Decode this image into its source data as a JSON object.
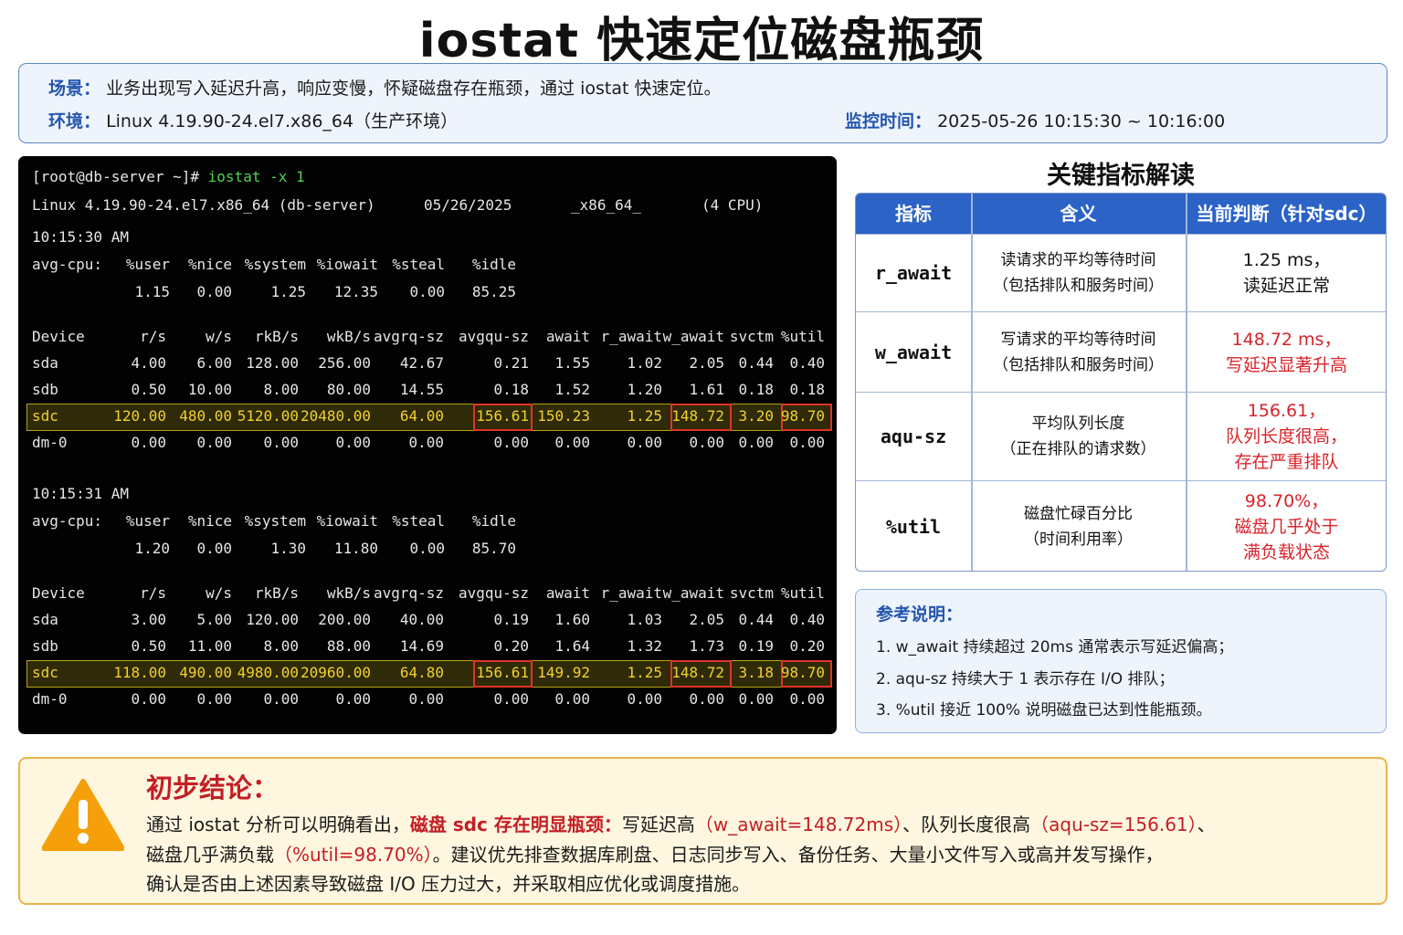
{
  "title": "iostat 快速定位磁盘瓶颈",
  "info": {
    "scene_label": "场景：",
    "scene_text": "业务出现写入延迟升高，响应变慢，怀疑磁盘存在瓶颈，通过 iostat 快速定位。",
    "env_label": "环境：",
    "env_text": "Linux 4.19.90-24.el7.x86_64（生产环境）",
    "time_label": "监控时间：",
    "time_text": "2025-05-26 10:15:30 ~ 10:16:00"
  },
  "terminal": {
    "prompt": "[root@db-server ~]# ",
    "command": "iostat -x 1",
    "sysinfo": {
      "kernel": "Linux 4.19.90-24.el7.x86_64 (db-server)",
      "date": "05/26/2025",
      "arch": "_x86_64_",
      "cpus": "(4 CPU)"
    },
    "cpu_headers": [
      "avg-cpu:",
      "%user",
      "%nice",
      "%system",
      "%iowait",
      "%steal",
      "%idle"
    ],
    "device_headers": [
      "Device",
      "r/s",
      "w/s",
      "rkB/s",
      "wkB/s",
      "avgrq-sz",
      "avgqu-sz",
      "await",
      "r_await",
      "w_await",
      "svctm",
      "%util"
    ],
    "samples": [
      {
        "time": "10:15:30 AM",
        "cpu": [
          "1.15",
          "0.00",
          "1.25",
          "12.35",
          "0.00",
          "85.25"
        ],
        "devices": [
          [
            "sda",
            "4.00",
            "6.00",
            "128.00",
            "256.00",
            "42.67",
            "0.21",
            "1.55",
            "1.02",
            "2.05",
            "0.44",
            "0.40"
          ],
          [
            "sdb",
            "0.50",
            "10.00",
            "8.00",
            "80.00",
            "14.55",
            "0.18",
            "1.52",
            "1.20",
            "1.61",
            "0.18",
            "0.18"
          ],
          [
            "sdc",
            "120.00",
            "480.00",
            "5120.00",
            "20480.00",
            "64.00",
            "156.61",
            "150.23",
            "1.25",
            "148.72",
            "3.20",
            "98.70"
          ],
          [
            "dm-0",
            "0.00",
            "0.00",
            "0.00",
            "0.00",
            "0.00",
            "0.00",
            "0.00",
            "0.00",
            "0.00",
            "0.00",
            "0.00"
          ]
        ]
      },
      {
        "time": "10:15:31 AM",
        "cpu": [
          "1.20",
          "0.00",
          "1.30",
          "11.80",
          "0.00",
          "85.70"
        ],
        "devices": [
          [
            "sda",
            "3.00",
            "5.00",
            "120.00",
            "200.00",
            "40.00",
            "0.19",
            "1.60",
            "1.03",
            "2.05",
            "0.44",
            "0.40"
          ],
          [
            "sdb",
            "0.50",
            "11.00",
            "8.00",
            "88.00",
            "14.69",
            "0.20",
            "1.64",
            "1.32",
            "1.73",
            "0.19",
            "0.20"
          ],
          [
            "sdc",
            "118.00",
            "490.00",
            "4980.00",
            "20960.00",
            "64.80",
            "156.61",
            "149.92",
            "1.25",
            "148.72",
            "3.18",
            "98.70"
          ],
          [
            "dm-0",
            "0.00",
            "0.00",
            "0.00",
            "0.00",
            "0.00",
            "0.00",
            "0.00",
            "0.00",
            "0.00",
            "0.00",
            "0.00"
          ]
        ]
      }
    ]
  },
  "metrics": {
    "title": "关键指标解读",
    "headers": [
      "指标",
      "含义",
      "当前判断（针对sdc）"
    ],
    "rows": [
      {
        "name": "r_await",
        "meaning": [
          "读请求的平均等待时间",
          "（包括排队和服务时间）"
        ],
        "judgement": [
          "1.25 ms，",
          "读延迟正常"
        ],
        "alert": false
      },
      {
        "name": "w_await",
        "meaning": [
          "写请求的平均等待时间",
          "（包括排队和服务时间）"
        ],
        "judgement": [
          "148.72 ms，",
          "写延迟显著升高"
        ],
        "alert": true
      },
      {
        "name": "aqu-sz",
        "meaning": [
          "平均队列长度",
          "（正在排队的请求数）"
        ],
        "judgement": [
          "156.61，",
          "队列长度很高，",
          "存在严重排队"
        ],
        "alert": true
      },
      {
        "name": "%util",
        "meaning": [
          "磁盘忙碌百分比",
          "（时间利用率）"
        ],
        "judgement": [
          "98.70%，",
          "磁盘几乎处于",
          "满负载状态"
        ],
        "alert": true
      }
    ]
  },
  "notes": {
    "title": "参考说明：",
    "items": [
      "1. w_await 持续超过 20ms 通常表示写延迟偏高；",
      "2. aqu-sz 持续大于 1 表示存在 I/O 排队；",
      "3. %util 接近 100% 说明磁盘已达到性能瓶颈。"
    ]
  },
  "conclusion": {
    "title": "初步结论：",
    "line1": {
      "a": "通过 iostat 分析可以明确看出，",
      "b": "磁盘 sdc 存在明显瓶颈：",
      "c": "写延迟高",
      "d": "（w_await=148.72ms）",
      "e": "、队列长度很高",
      "f": "（aqu-sz=156.61）",
      "g": "、"
    },
    "line2": {
      "a": "磁盘几乎满负载",
      "b": "（%util=98.70%）",
      "c": "。建议优先排查数据库刷盘、日志同步写入、备份任务、大量小文件写入或高并发写操作，"
    },
    "line3": "确认是否由上述因素导致磁盘 I/O 压力过大，并采取相应优化或调度措施。"
  },
  "colors": {
    "accent_blue": "#2b63c6",
    "alert_red": "#d8232a",
    "terminal_green": "#4fd64f",
    "highlight_yellow": "#f2d22e"
  }
}
